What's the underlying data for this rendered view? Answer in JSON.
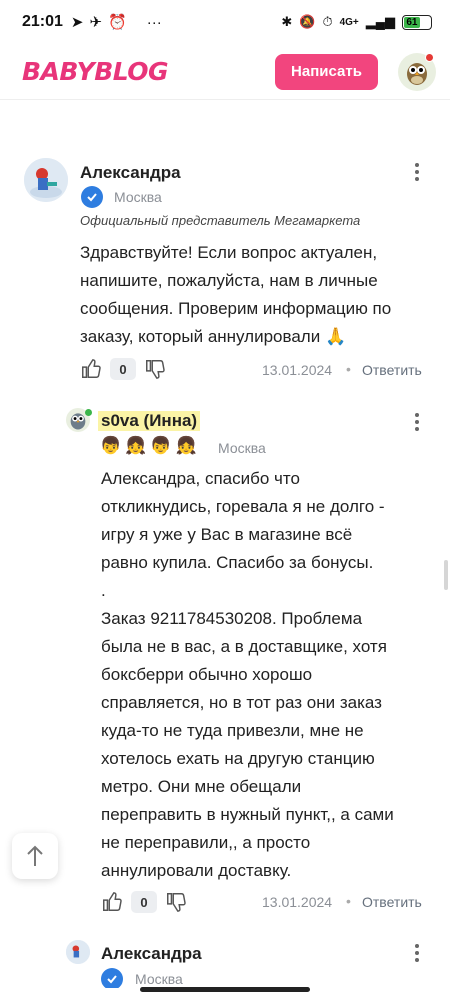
{
  "status_bar": {
    "time": "21:01",
    "network": "4G+",
    "battery": "61"
  },
  "header": {
    "logo": "BABYBLOG",
    "write_button": "Написать"
  },
  "comments": [
    {
      "author": "Александра",
      "city": "Москва",
      "role": "Официальный представитель Мегамаркета",
      "lines": [
        "Здравствуйте! Если вопрос актуален,",
        "напишите, пожалуйста, нам в личные",
        "сообщения. Проверим информацию по",
        "заказу, который аннулировали 🙏"
      ],
      "likes": "0",
      "date": "13.01.2024",
      "reply": "Ответить"
    },
    {
      "author": "s0va (Инна)",
      "city": "Москва",
      "emojis": "👦👧👦👧",
      "lines": [
        "Александра, спасибо что",
        "откликнудись, горевала я не долго -",
        "игру я уже у Вас в магазине всё",
        "равно купила. Спасибо за бонусы.",
        ".",
        "Заказ 9211784530208. Проблема",
        "была не в вас, а в доставщике, хотя",
        "боксберри обычно хорошо",
        "справляется, но в тот раз они заказ",
        "куда-то не туда привезли, мне не",
        "хотелось ехать на другую станцию",
        "метро. Они мне обещали",
        "переправить в нужный пункт,, а сами",
        "не переправили,, а просто",
        "аннулировали доставку."
      ],
      "likes": "0",
      "date": "13.01.2024",
      "reply": "Ответить"
    },
    {
      "author": "Александра",
      "city": "Москва"
    }
  ],
  "colors": {
    "brand": "#e8357a",
    "button": "#f2457e",
    "verify": "#2e7de0",
    "highlight": "#fbf4a6"
  }
}
